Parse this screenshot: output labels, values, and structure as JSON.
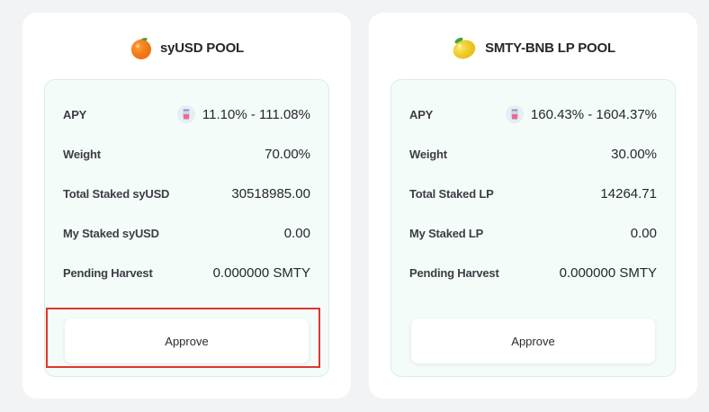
{
  "pools": [
    {
      "title": "syUSD POOL",
      "icon": "orange-icon",
      "rows": [
        {
          "label": "APY",
          "value": "11.10% - 111.08%"
        },
        {
          "label": "Weight",
          "value": "70.00%"
        },
        {
          "label": "Total Staked syUSD",
          "value": "30518985.00"
        },
        {
          "label": "My Staked syUSD",
          "value": "0.00"
        },
        {
          "label": "Pending Harvest",
          "value": "0.000000 SMTY"
        }
      ],
      "button_label": "Approve"
    },
    {
      "title": "SMTY-BNB LP POOL",
      "icon": "lemon-icon",
      "rows": [
        {
          "label": "APY",
          "value": "160.43% - 1604.37%"
        },
        {
          "label": "Weight",
          "value": "30.00%"
        },
        {
          "label": "Total Staked LP",
          "value": "14264.71"
        },
        {
          "label": "My Staked LP",
          "value": "0.00"
        },
        {
          "label": "Pending Harvest",
          "value": "0.000000 SMTY"
        }
      ],
      "button_label": "Approve"
    }
  ],
  "colors": {
    "background": "#f2f3f5",
    "card": "#ffffff",
    "inner_panel": "#f4fcfa",
    "highlight": "#e0362c"
  }
}
